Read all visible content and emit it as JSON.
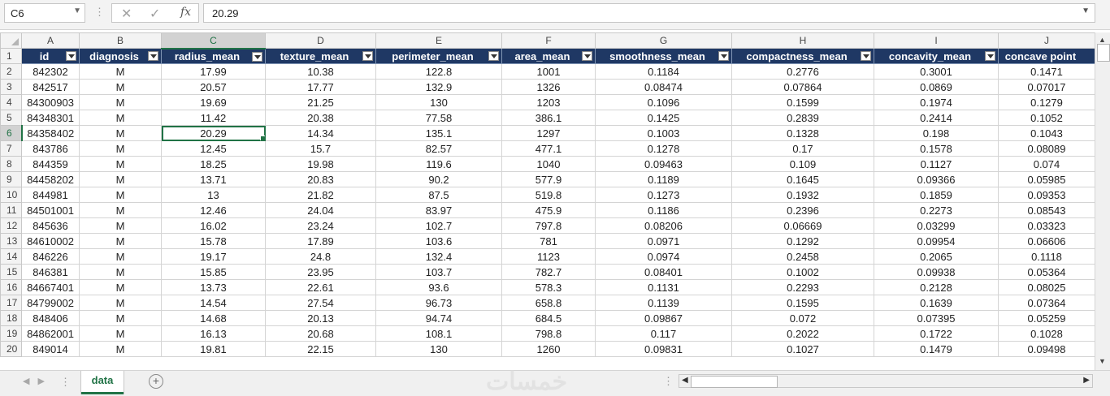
{
  "name_box": "C6",
  "formula_value": "20.29",
  "formula_fx": "fx",
  "formula_cancel": "✕",
  "formula_enter": "✓",
  "columns": [
    "A",
    "B",
    "C",
    "D",
    "E",
    "F",
    "G",
    "H",
    "I",
    "J"
  ],
  "header_row_number": "1",
  "headers": [
    "id",
    "diagnosis",
    "radius_mean",
    "texture_mean",
    "perimeter_mean",
    "area_mean",
    "smoothness_mean",
    "compactness_mean",
    "concavity_mean",
    "concave point"
  ],
  "rows": [
    {
      "n": "2",
      "cells": [
        "842302",
        "M",
        "17.99",
        "10.38",
        "122.8",
        "1001",
        "0.1184",
        "0.2776",
        "0.3001",
        "0.1471"
      ]
    },
    {
      "n": "3",
      "cells": [
        "842517",
        "M",
        "20.57",
        "17.77",
        "132.9",
        "1326",
        "0.08474",
        "0.07864",
        "0.0869",
        "0.07017"
      ]
    },
    {
      "n": "4",
      "cells": [
        "84300903",
        "M",
        "19.69",
        "21.25",
        "130",
        "1203",
        "0.1096",
        "0.1599",
        "0.1974",
        "0.1279"
      ]
    },
    {
      "n": "5",
      "cells": [
        "84348301",
        "M",
        "11.42",
        "20.38",
        "77.58",
        "386.1",
        "0.1425",
        "0.2839",
        "0.2414",
        "0.1052"
      ]
    },
    {
      "n": "6",
      "cells": [
        "84358402",
        "M",
        "20.29",
        "14.34",
        "135.1",
        "1297",
        "0.1003",
        "0.1328",
        "0.198",
        "0.1043"
      ]
    },
    {
      "n": "7",
      "cells": [
        "843786",
        "M",
        "12.45",
        "15.7",
        "82.57",
        "477.1",
        "0.1278",
        "0.17",
        "0.1578",
        "0.08089"
      ]
    },
    {
      "n": "8",
      "cells": [
        "844359",
        "M",
        "18.25",
        "19.98",
        "119.6",
        "1040",
        "0.09463",
        "0.109",
        "0.1127",
        "0.074"
      ]
    },
    {
      "n": "9",
      "cells": [
        "84458202",
        "M",
        "13.71",
        "20.83",
        "90.2",
        "577.9",
        "0.1189",
        "0.1645",
        "0.09366",
        "0.05985"
      ]
    },
    {
      "n": "10",
      "cells": [
        "844981",
        "M",
        "13",
        "21.82",
        "87.5",
        "519.8",
        "0.1273",
        "0.1932",
        "0.1859",
        "0.09353"
      ]
    },
    {
      "n": "11",
      "cells": [
        "84501001",
        "M",
        "12.46",
        "24.04",
        "83.97",
        "475.9",
        "0.1186",
        "0.2396",
        "0.2273",
        "0.08543"
      ]
    },
    {
      "n": "12",
      "cells": [
        "845636",
        "M",
        "16.02",
        "23.24",
        "102.7",
        "797.8",
        "0.08206",
        "0.06669",
        "0.03299",
        "0.03323"
      ]
    },
    {
      "n": "13",
      "cells": [
        "84610002",
        "M",
        "15.78",
        "17.89",
        "103.6",
        "781",
        "0.0971",
        "0.1292",
        "0.09954",
        "0.06606"
      ]
    },
    {
      "n": "14",
      "cells": [
        "846226",
        "M",
        "19.17",
        "24.8",
        "132.4",
        "1123",
        "0.0974",
        "0.2458",
        "0.2065",
        "0.1118"
      ]
    },
    {
      "n": "15",
      "cells": [
        "846381",
        "M",
        "15.85",
        "23.95",
        "103.7",
        "782.7",
        "0.08401",
        "0.1002",
        "0.09938",
        "0.05364"
      ]
    },
    {
      "n": "16",
      "cells": [
        "84667401",
        "M",
        "13.73",
        "22.61",
        "93.6",
        "578.3",
        "0.1131",
        "0.2293",
        "0.2128",
        "0.08025"
      ]
    },
    {
      "n": "17",
      "cells": [
        "84799002",
        "M",
        "14.54",
        "27.54",
        "96.73",
        "658.8",
        "0.1139",
        "0.1595",
        "0.1639",
        "0.07364"
      ]
    },
    {
      "n": "18",
      "cells": [
        "848406",
        "M",
        "14.68",
        "20.13",
        "94.74",
        "684.5",
        "0.09867",
        "0.072",
        "0.07395",
        "0.05259"
      ]
    },
    {
      "n": "19",
      "cells": [
        "84862001",
        "M",
        "16.13",
        "20.68",
        "108.1",
        "798.8",
        "0.117",
        "0.2022",
        "0.1722",
        "0.1028"
      ]
    },
    {
      "n": "20",
      "cells": [
        "849014",
        "M",
        "19.81",
        "22.15",
        "130",
        "1260",
        "0.09831",
        "0.1027",
        "0.1479",
        "0.09498"
      ]
    }
  ],
  "sheet_tab": "data",
  "add_sheet": "+",
  "watermark": "خمسات",
  "accent_color": "#217346",
  "header_fill": "#1f3864"
}
